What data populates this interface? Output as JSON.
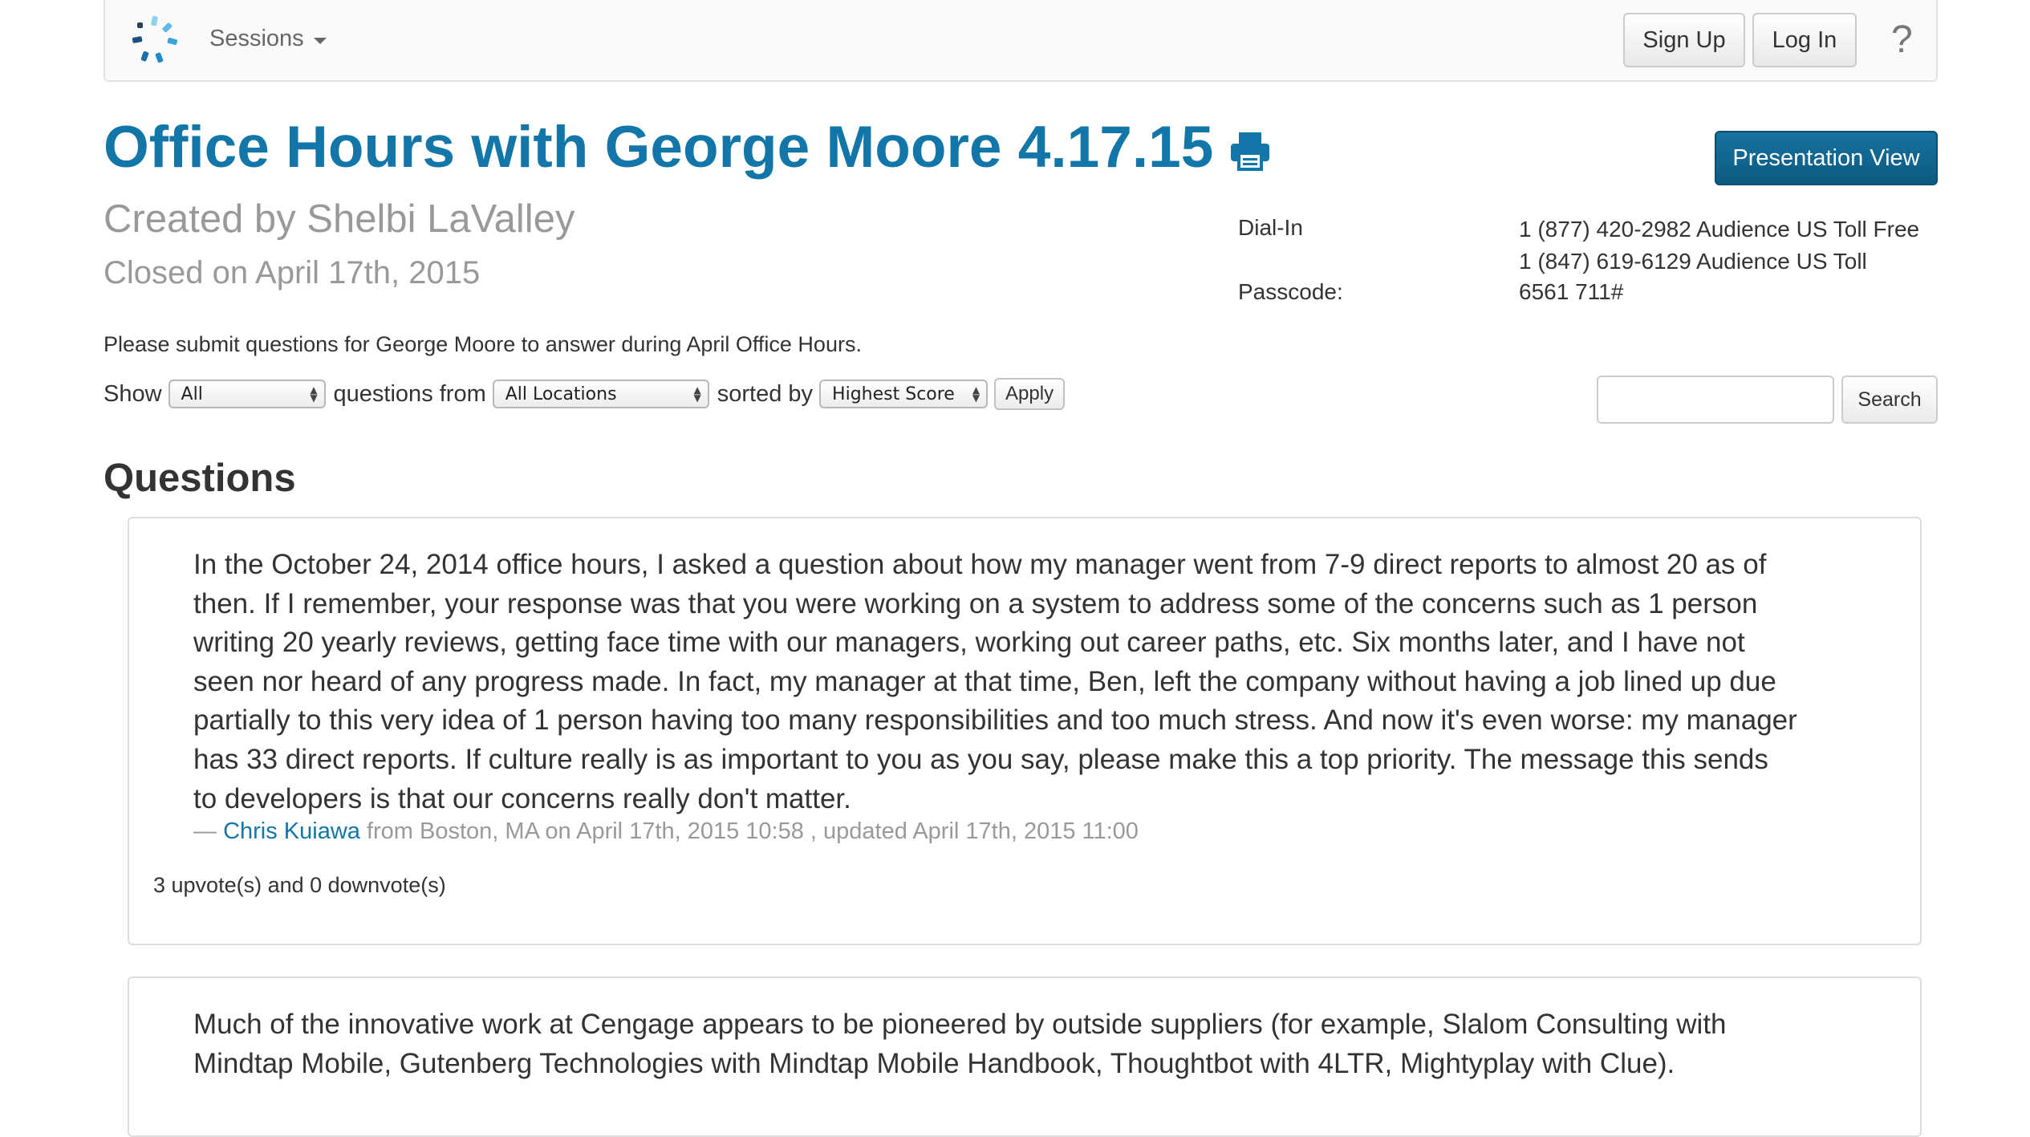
{
  "nav": {
    "sessions_label": "Sessions",
    "signup_label": "Sign Up",
    "login_label": "Log In",
    "help_label": "?"
  },
  "header": {
    "title": "Office Hours with George Moore 4.17.15",
    "presentation_view_label": "Presentation View",
    "created_by": "Created by Shelbi LaValley",
    "closed_on": "Closed on April 17th, 2015"
  },
  "dial_in": {
    "dial_label": "Dial-In",
    "numbers": [
      "1 (877) 420-2982 Audience US Toll Free",
      "1 (847) 619-6129 Audience US Toll"
    ],
    "passcode_label": "Passcode:",
    "passcode": "6561 711#"
  },
  "description": "Please submit questions for George Moore to answer during April Office Hours.",
  "filters": {
    "show_label": "Show",
    "show_value": "All",
    "from_label": "questions from",
    "location_value": "All Locations",
    "sorted_label": "sorted by",
    "sort_value": "Highest Score",
    "apply_label": "Apply",
    "search_label": "Search",
    "search_value": ""
  },
  "questions_heading": "Questions",
  "questions": [
    {
      "text": "In the October 24, 2014 office hours, I asked a question about how my manager went from 7-9 direct reports to almost 20 as of then. If I remember, your response was that you were working on a system to address some of the concerns such as 1 person writing 20 yearly reviews, getting face time with our managers, working out career paths, etc. Six months later, and I have not seen nor heard of any progress made. In fact, my manager at that time, Ben, left the company without having a job lined up due partially to this very idea of 1 person having too many responsibilities and too much stress. And now it's even worse: my manager has 33 direct reports. If culture really is as important to you as you say, please make this a top priority. The message this sends to developers is that our concerns really don't matter.",
      "dash": "—",
      "author": "Chris Kuiawa",
      "meta_rest": "from Boston, MA on April 17th, 2015 10:58 , updated April 17th, 2015 11:00",
      "votes": "3 upvote(s) and 0 downvote(s)"
    },
    {
      "text": "Much of the innovative work at Cengage appears to be pioneered by outside suppliers (for example, Slalom Consulting with Mindtap Mobile, Gutenberg Technologies with Mindtap Mobile Handbook, Thoughtbot with 4LTR, Mightyplay with Clue)."
    }
  ],
  "colors": {
    "link_blue": "#1276a8",
    "primary_button": "#0d5a80",
    "muted_text": "#999999"
  }
}
